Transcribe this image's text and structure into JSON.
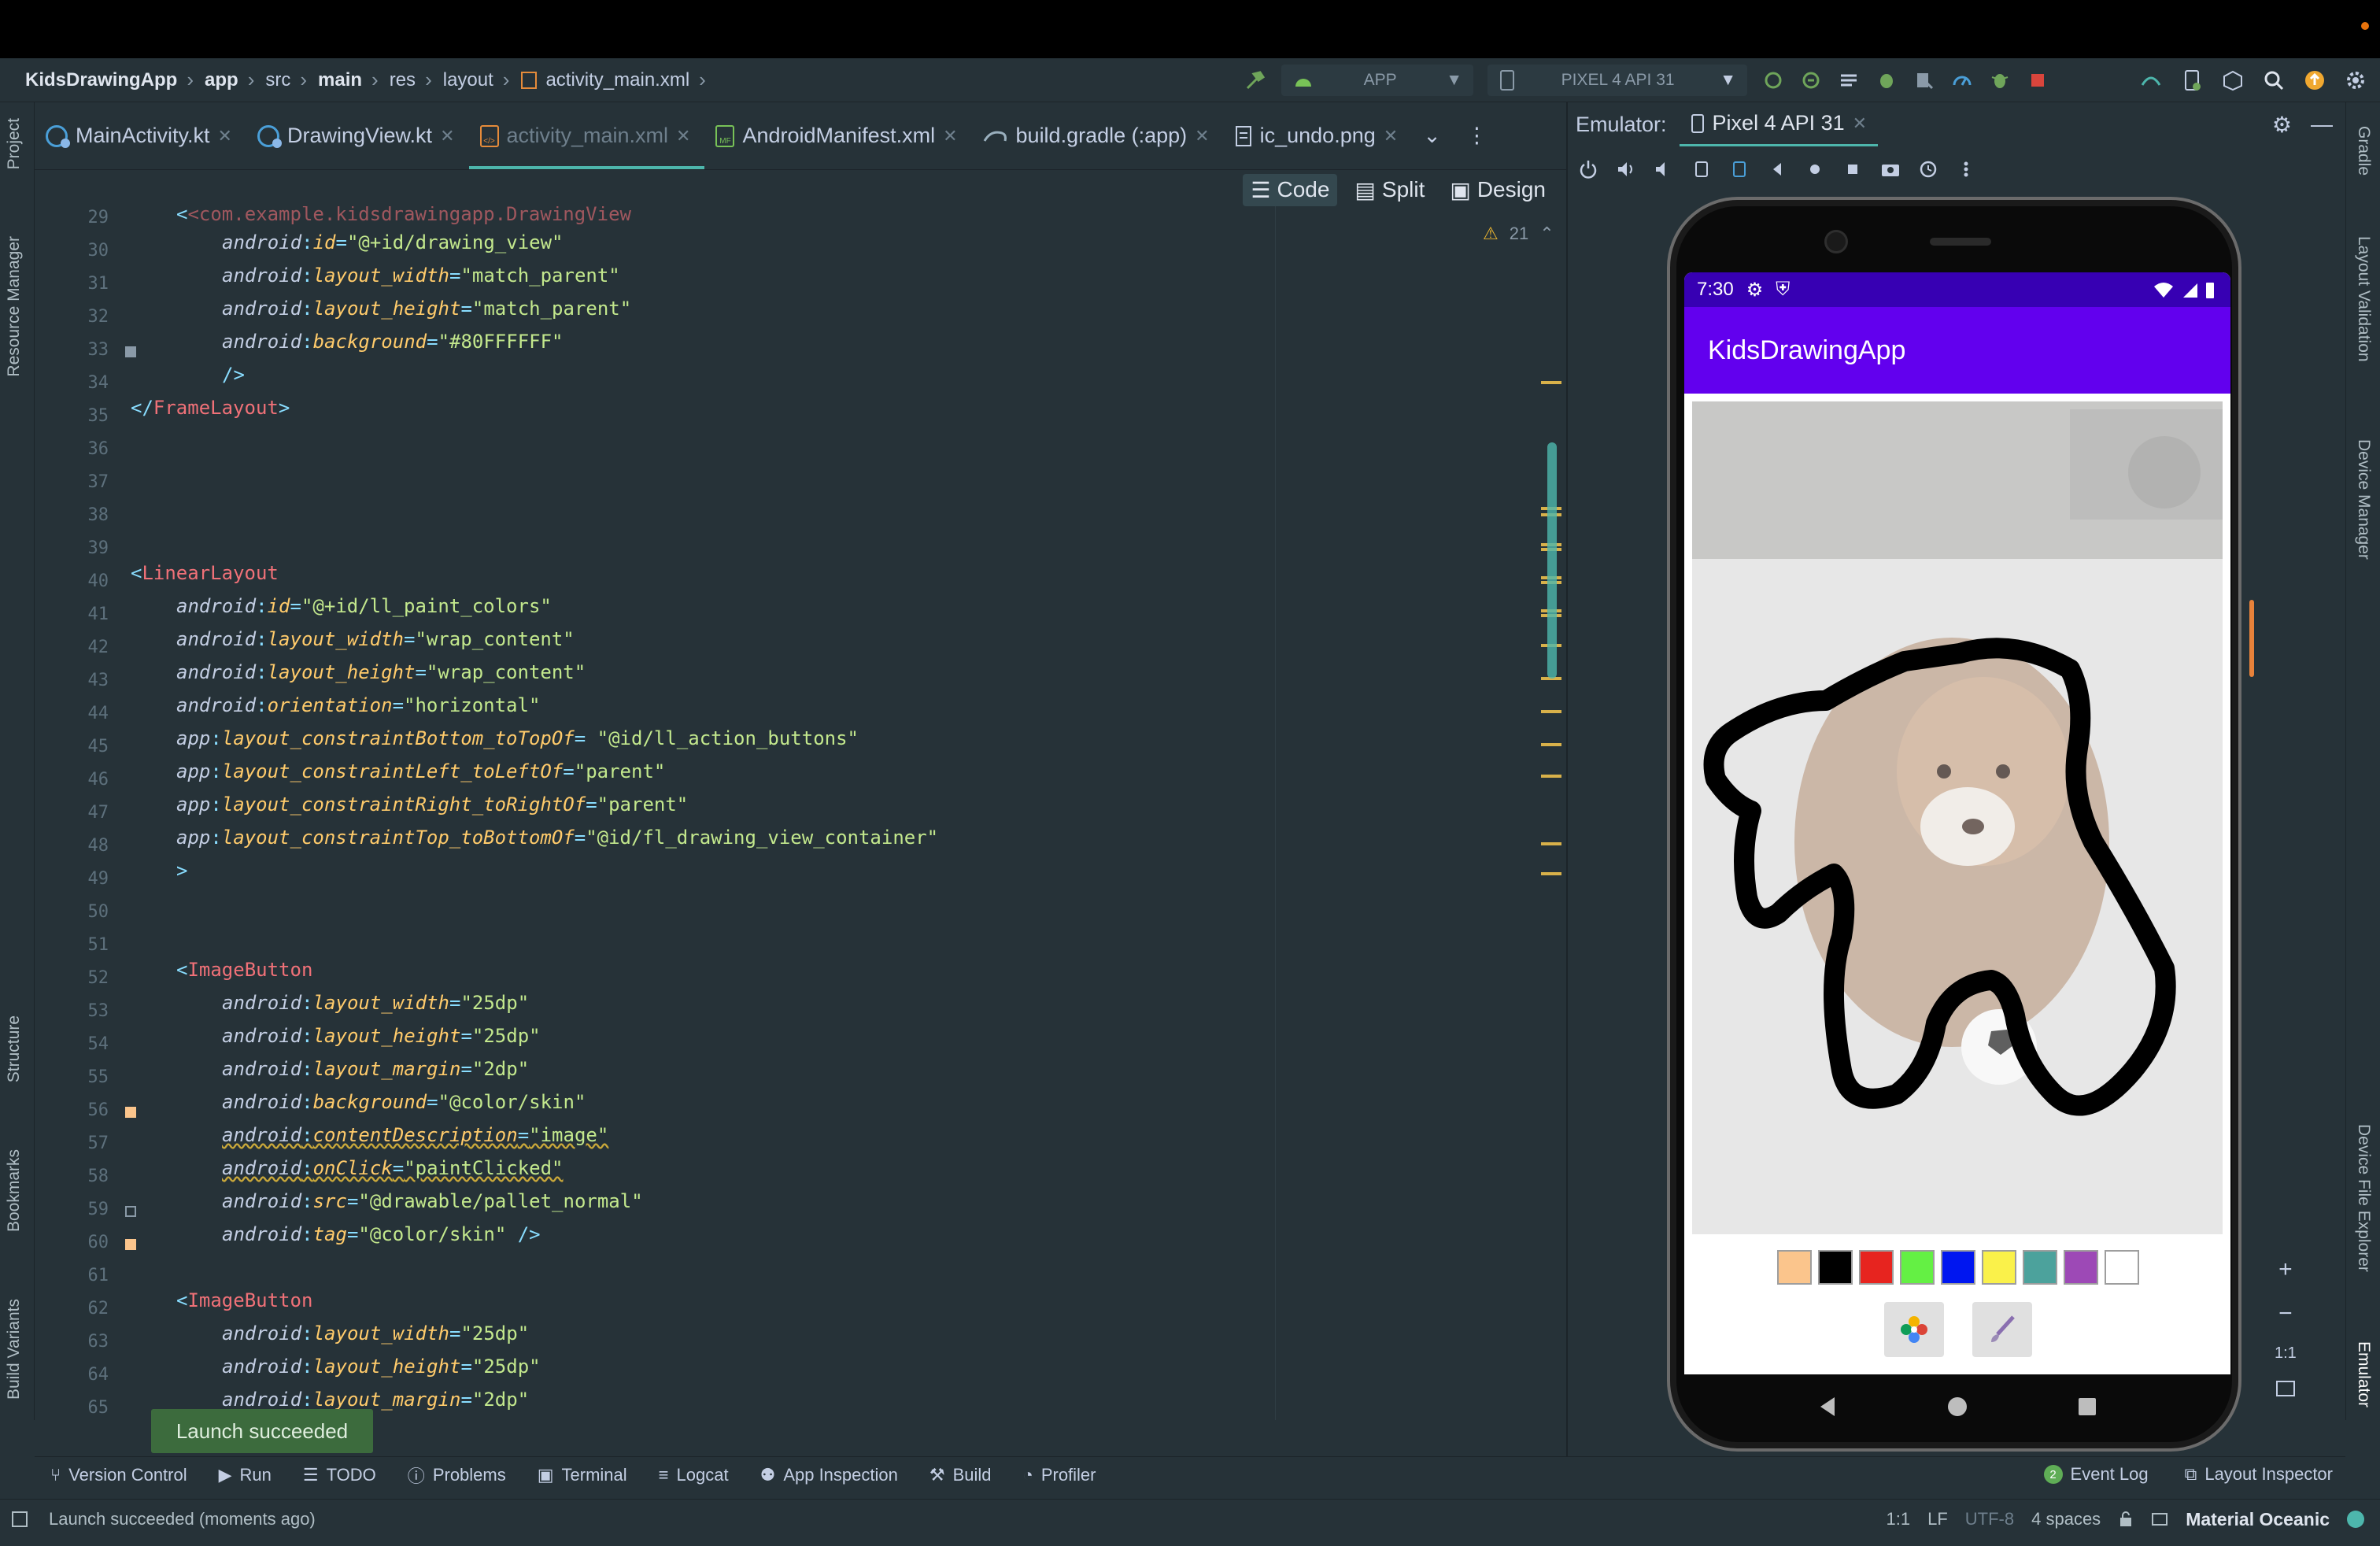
{
  "breadcrumb": [
    "KidsDrawingApp",
    "app",
    "src",
    "main",
    "res",
    "layout",
    "activity_main.xml"
  ],
  "run_config": {
    "app": "APP",
    "device": "PIXEL 4 API 31"
  },
  "tabs": [
    {
      "label": "MainActivity.kt"
    },
    {
      "label": "DrawingView.kt"
    },
    {
      "label": "activity_main.xml"
    },
    {
      "label": "AndroidManifest.xml"
    },
    {
      "label": "build.gradle (:app)"
    },
    {
      "label": "ic_undo.png"
    }
  ],
  "view_modes": {
    "code": "Code",
    "split": "Split",
    "design": "Design"
  },
  "warnings": {
    "count": "21"
  },
  "left_tool_windows": {
    "project": "Project",
    "resource_manager": "Resource Manager",
    "structure": "Structure",
    "bookmarks": "Bookmarks",
    "build_variants": "Build Variants"
  },
  "right_tool_windows": {
    "gradle": "Gradle",
    "layout_validation": "Layout Validation",
    "device_manager": "Device Manager",
    "device_file_explorer": "Device File Explorer",
    "emulator": "Emulator"
  },
  "code": {
    "l29": "<com.example.kidsdrawingapp.DrawingView",
    "l30_attr": "id",
    "l30_val": "\"@+id/drawing_view\"",
    "l31_attr": "layout_width",
    "l31_val": "\"match_parent\"",
    "l32_attr": "layout_height",
    "l32_val": "\"match_parent\"",
    "l33_attr": "background",
    "l33_val": "\"#80FFFFFF\"",
    "l34": "/>",
    "l35_tag": "FrameLayout",
    "l40_tag": "LinearLayout",
    "l41_attr": "id",
    "l41_val": "\"@+id/ll_paint_colors\"",
    "l42_attr": "layout_width",
    "l42_val": "\"wrap_content\"",
    "l43_attr": "layout_height",
    "l43_val": "\"wrap_content\"",
    "l44_attr": "orientation",
    "l44_val": "\"horizontal\"",
    "l45_attr": "layout_constraintBottom_toTopOf",
    "l45_val": " \"@id/ll_action_buttons\"",
    "l46_attr": "layout_constraintLeft_toLeftOf",
    "l46_val": "\"parent\"",
    "l47_attr": "layout_constraintRight_toRightOf",
    "l47_val": "\"parent\"",
    "l48_attr": "layout_constraintTop_toBottomOf",
    "l48_val": "\"@id/fl_drawing_view_container\"",
    "l49": ">",
    "l52_tag": "ImageButton",
    "l53_attr": "layout_width",
    "l53_val": "\"25dp\"",
    "l54_attr": "layout_height",
    "l54_val": "\"25dp\"",
    "l55_attr": "layout_margin",
    "l55_val": "\"2dp\"",
    "l56_attr": "background",
    "l56_val": "\"@color/skin\"",
    "l57_attr": "contentDescription",
    "l57_val": "\"image\"",
    "l58_attr": "onClick",
    "l58_val": "\"paintClicked\"",
    "l59_attr": "src",
    "l59_val": "\"@drawable/pallet_normal\"",
    "l60_attr": "tag",
    "l60_val": "\"@color/skin\"",
    "l60_end": " />",
    "l62_tag": "ImageButton",
    "l63_attr": "layout_width",
    "l63_val": "\"25dp\"",
    "l64_attr": "layout_height",
    "l64_val": "\"25dp\"",
    "l65_attr": "layout_margin",
    "l65_val": "\"2dp\"",
    "ns_android": "android",
    "ns_app": "app",
    "line_numbers": [
      "29",
      "30",
      "31",
      "32",
      "33",
      "34",
      "35",
      "36",
      "37",
      "38",
      "39",
      "40",
      "41",
      "42",
      "43",
      "44",
      "45",
      "46",
      "47",
      "48",
      "49",
      "50",
      "51",
      "52",
      "53",
      "54",
      "55",
      "56",
      "57",
      "58",
      "59",
      "60",
      "61",
      "62",
      "63",
      "64",
      "65"
    ]
  },
  "toast": "Launch succeeded",
  "emulator": {
    "label": "Emulator:",
    "device_tab": "Pixel 4 API 31",
    "zoom_ratio": "1:1"
  },
  "phone": {
    "time": "7:30",
    "app_title": "KidsDrawingApp",
    "palette": [
      "#fbc58c",
      "#000000",
      "#e7241f",
      "#64f044",
      "#0016f0",
      "#faf14a",
      "#4ca29c",
      "#9d49b6",
      "#ffffff"
    ]
  },
  "bottom_tools": {
    "version_control": "Version Control",
    "run": "Run",
    "todo": "TODO",
    "problems": "Problems",
    "terminal": "Terminal",
    "logcat": "Logcat",
    "app_inspection": "App Inspection",
    "build": "Build",
    "profiler": "Profiler",
    "event_log": "Event Log",
    "event_count": "2",
    "layout_inspector": "Layout Inspector"
  },
  "status_bar": {
    "message": "Launch succeeded (moments ago)",
    "position": "1:1",
    "line_sep": "LF",
    "encoding": "UTF-8",
    "indent": "4 spaces",
    "theme": "Material Oceanic"
  },
  "colors": {
    "accent": "#4db6ac",
    "app_bar": "#6200ee",
    "status_bar": "#3700b3"
  }
}
